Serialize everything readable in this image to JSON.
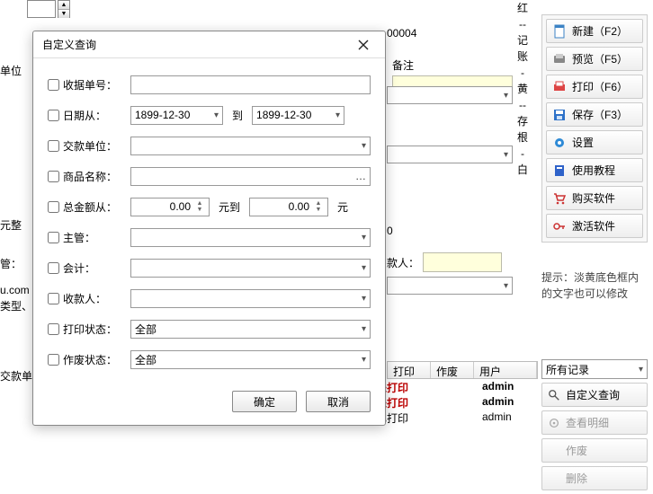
{
  "topbar": {
    "doc_no_partial": "00004",
    "unit_label": "单位",
    "remark_label": "备注"
  },
  "vertical_sidebar": "红--记账-黄--存根-白",
  "right_toolbar": {
    "items": [
      {
        "name": "new",
        "label": "新建（F2）"
      },
      {
        "name": "preview",
        "label": "预览（F5）"
      },
      {
        "name": "print",
        "label": "打印（F6）"
      },
      {
        "name": "save",
        "label": "保存（F3）"
      },
      {
        "name": "settings",
        "label": "设置"
      },
      {
        "name": "tutorial",
        "label": "使用教程"
      },
      {
        "name": "buy",
        "label": "购买软件"
      },
      {
        "name": "activate",
        "label": "激活软件"
      }
    ],
    "hint": "提示：淡黄底色框内的文字也可以修改"
  },
  "left_cut_labels": {
    "yuanzheng": "元整",
    "guan": "管：",
    "urlpart": "u.com",
    "leixing": "类型、",
    "jiaokuandan": "交款单"
  },
  "bg_fields": {
    "shoukuanren": "款人：",
    "zero": "0"
  },
  "dialog": {
    "title": "自定义查询",
    "fields": {
      "receipt_no": {
        "label": "收据单号：",
        "value": ""
      },
      "date_from": {
        "label": "日期从：",
        "from": "1899-12-30",
        "to_label": "到",
        "to": "1899-12-30"
      },
      "payer_unit": {
        "label": "交款单位：",
        "value": ""
      },
      "product": {
        "label": "商品名称：",
        "value": ""
      },
      "amount": {
        "label": "总金额从：",
        "from": "0.00",
        "mid": "元到",
        "to": "0.00",
        "suffix": "元"
      },
      "director": {
        "label": "主管：",
        "value": ""
      },
      "accountant": {
        "label": "会计：",
        "value": ""
      },
      "payee": {
        "label": "收款人：",
        "value": ""
      },
      "print_status": {
        "label": "打印状态：",
        "value": "全部"
      },
      "void_status": {
        "label": "作废状态：",
        "value": "全部"
      }
    },
    "ok": "确定",
    "cancel": "取消"
  },
  "table": {
    "headers": {
      "print": "打印",
      "void": "作废",
      "user": "用户"
    },
    "rows": [
      {
        "print": "未打印",
        "void": "",
        "user": "admin"
      },
      {
        "print": "未打印",
        "void": "",
        "user": "admin"
      },
      {
        "print": "已打印",
        "void": "",
        "user": "admin"
      }
    ]
  },
  "right_list": {
    "filter": "所有记录",
    "custom_query": "自定义查询",
    "view_detail": "查看明细",
    "void": "作废",
    "delete": "删除"
  },
  "icons": {
    "magnifier": "🔍",
    "doc": "🗎",
    "preview": "🖶",
    "print": "🖨",
    "save": "💾",
    "gear": "⚙",
    "book": "📘",
    "cart": "🛒",
    "key": "🔑",
    "x": "✕"
  }
}
